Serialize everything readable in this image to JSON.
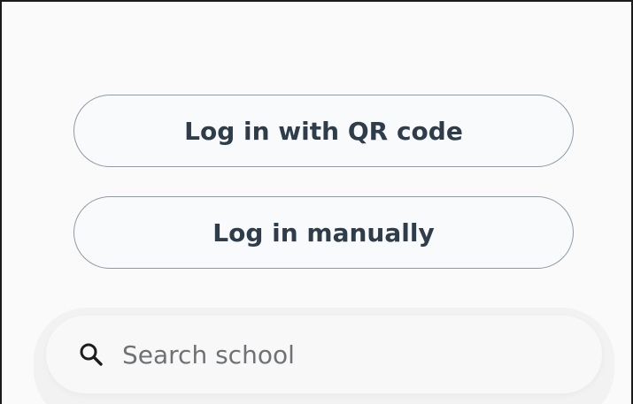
{
  "login": {
    "qr_label": "Log in with QR code",
    "manual_label": "Log in manually"
  },
  "search": {
    "placeholder": "Search school",
    "icon": "search-icon"
  },
  "colors": {
    "button_text": "#2f3d4a",
    "button_border": "#8f9aa8",
    "placeholder_text": "#6e7275",
    "background": "#fafafa"
  }
}
